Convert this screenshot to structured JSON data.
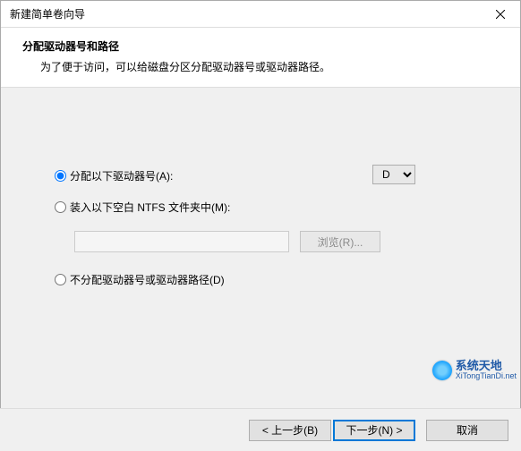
{
  "window": {
    "title": "新建简单卷向导"
  },
  "header": {
    "title": "分配驱动器号和路径",
    "subtitle": "为了便于访问，可以给磁盘分区分配驱动器号或驱动器路径。"
  },
  "options": {
    "assign_letter_label": "分配以下驱动器号(A):",
    "mount_folder_label": "装入以下空白 NTFS 文件夹中(M):",
    "no_assign_label": "不分配驱动器号或驱动器路径(D)",
    "selected": "assign_letter",
    "drive_letter": "D",
    "mount_path": "",
    "browse_label": "浏览(R)..."
  },
  "footer": {
    "back": "< 上一步(B)",
    "next": "下一步(N) >",
    "cancel": "取消"
  },
  "watermark": {
    "text": "系统天地",
    "sub": "XiTongTianDi.net"
  }
}
